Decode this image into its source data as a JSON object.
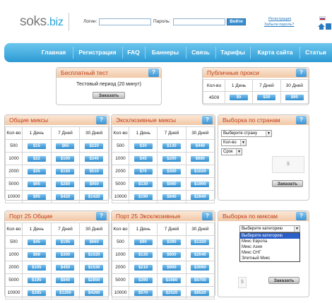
{
  "header": {
    "logo_main": "soks",
    "logo_tld": ".biz",
    "login_label": "Логин:",
    "password_label": "Пароль:",
    "login_button": "Войти",
    "register_link": "Регистрация",
    "forgot_link": "Забыли пароль?"
  },
  "nav": {
    "items": [
      "Главная",
      "Регистрация",
      "FAQ",
      "Баннеры",
      "Связь",
      "Тарифы",
      "Карта сайта",
      "Статьи"
    ]
  },
  "free_test": {
    "title": "Бесплатный тест",
    "text": "Тестовый период (20 минут)",
    "button": "Заказать"
  },
  "public": {
    "title": "Публичные прокси",
    "headers": [
      "Кол-во",
      "1 День",
      "7 Дней",
      "30 Дней"
    ],
    "row": [
      "4509",
      "$5",
      "$30",
      "$90"
    ]
  },
  "common": {
    "title": "Общие миксы",
    "headers": [
      "Кол-во",
      "1 День",
      "7 Дней",
      "30 Дней"
    ],
    "rows": [
      [
        "500",
        "$15",
        "$65",
        "$220"
      ],
      [
        "1000",
        "$22",
        "$100",
        "$340"
      ],
      [
        "2000",
        "$35",
        "$150",
        "$510"
      ],
      [
        "5000",
        "$65",
        "$280",
        "$950"
      ],
      [
        "10000",
        "$95",
        "$420",
        "$1420"
      ]
    ]
  },
  "exclusive": {
    "title": "Эксклюзивные миксы",
    "headers": [
      "Кол-во",
      "1 День",
      "7 Дней",
      "30 Дней"
    ],
    "rows": [
      [
        "500",
        "$30",
        "$130",
        "$440"
      ],
      [
        "1000",
        "$45",
        "$200",
        "$680"
      ],
      [
        "2000",
        "$70",
        "$300",
        "$1020"
      ],
      [
        "5000",
        "$130",
        "$560",
        "$1900"
      ],
      [
        "10000",
        "$190",
        "$840",
        "$2840"
      ]
    ]
  },
  "by_country": {
    "title": "Выборка по странам",
    "select_country": "Выберите страну",
    "select_qty": "Кол-во",
    "select_term": "Срок",
    "price_symbol": "$",
    "button": "Заказать"
  },
  "port25": {
    "title": "Порт 25 Общие",
    "headers": [
      "Кол-во",
      "1 День",
      "7 Дней",
      "30 Дней"
    ],
    "rows": [
      [
        "500",
        "$45",
        "$195",
        "$660"
      ],
      [
        "1000",
        "$68",
        "$300",
        "$1020"
      ],
      [
        "2000",
        "$105",
        "$450",
        "$1530"
      ],
      [
        "5000",
        "$195",
        "$840",
        "$2850"
      ],
      [
        "10000",
        "$285",
        "$1260",
        "$4260"
      ]
    ]
  },
  "port25ex": {
    "title": "Порт 25 Эксклюзивные",
    "headers": [
      "Кол-во",
      "1 День",
      "7 Дней",
      "30 Дней"
    ],
    "rows": [
      [
        "500",
        "$90",
        "$390",
        "$1320"
      ],
      [
        "1000",
        "$135",
        "$600",
        "$2040"
      ],
      [
        "2000",
        "$210",
        "$900",
        "$3060"
      ],
      [
        "5000",
        "$390",
        "$1680",
        "$5700"
      ],
      [
        "10000",
        "$570",
        "$2520",
        "$8520"
      ]
    ]
  },
  "by_mix": {
    "title": "Выборка по миксам",
    "select_category": "Выберите категорию",
    "options": [
      "Выберите категорию",
      "Микс Европа",
      "Микс Азия",
      "Микс СНГ",
      "Элитный Микс"
    ],
    "price_symbol": "$",
    "button": "Заказать"
  },
  "help_label": "?"
}
